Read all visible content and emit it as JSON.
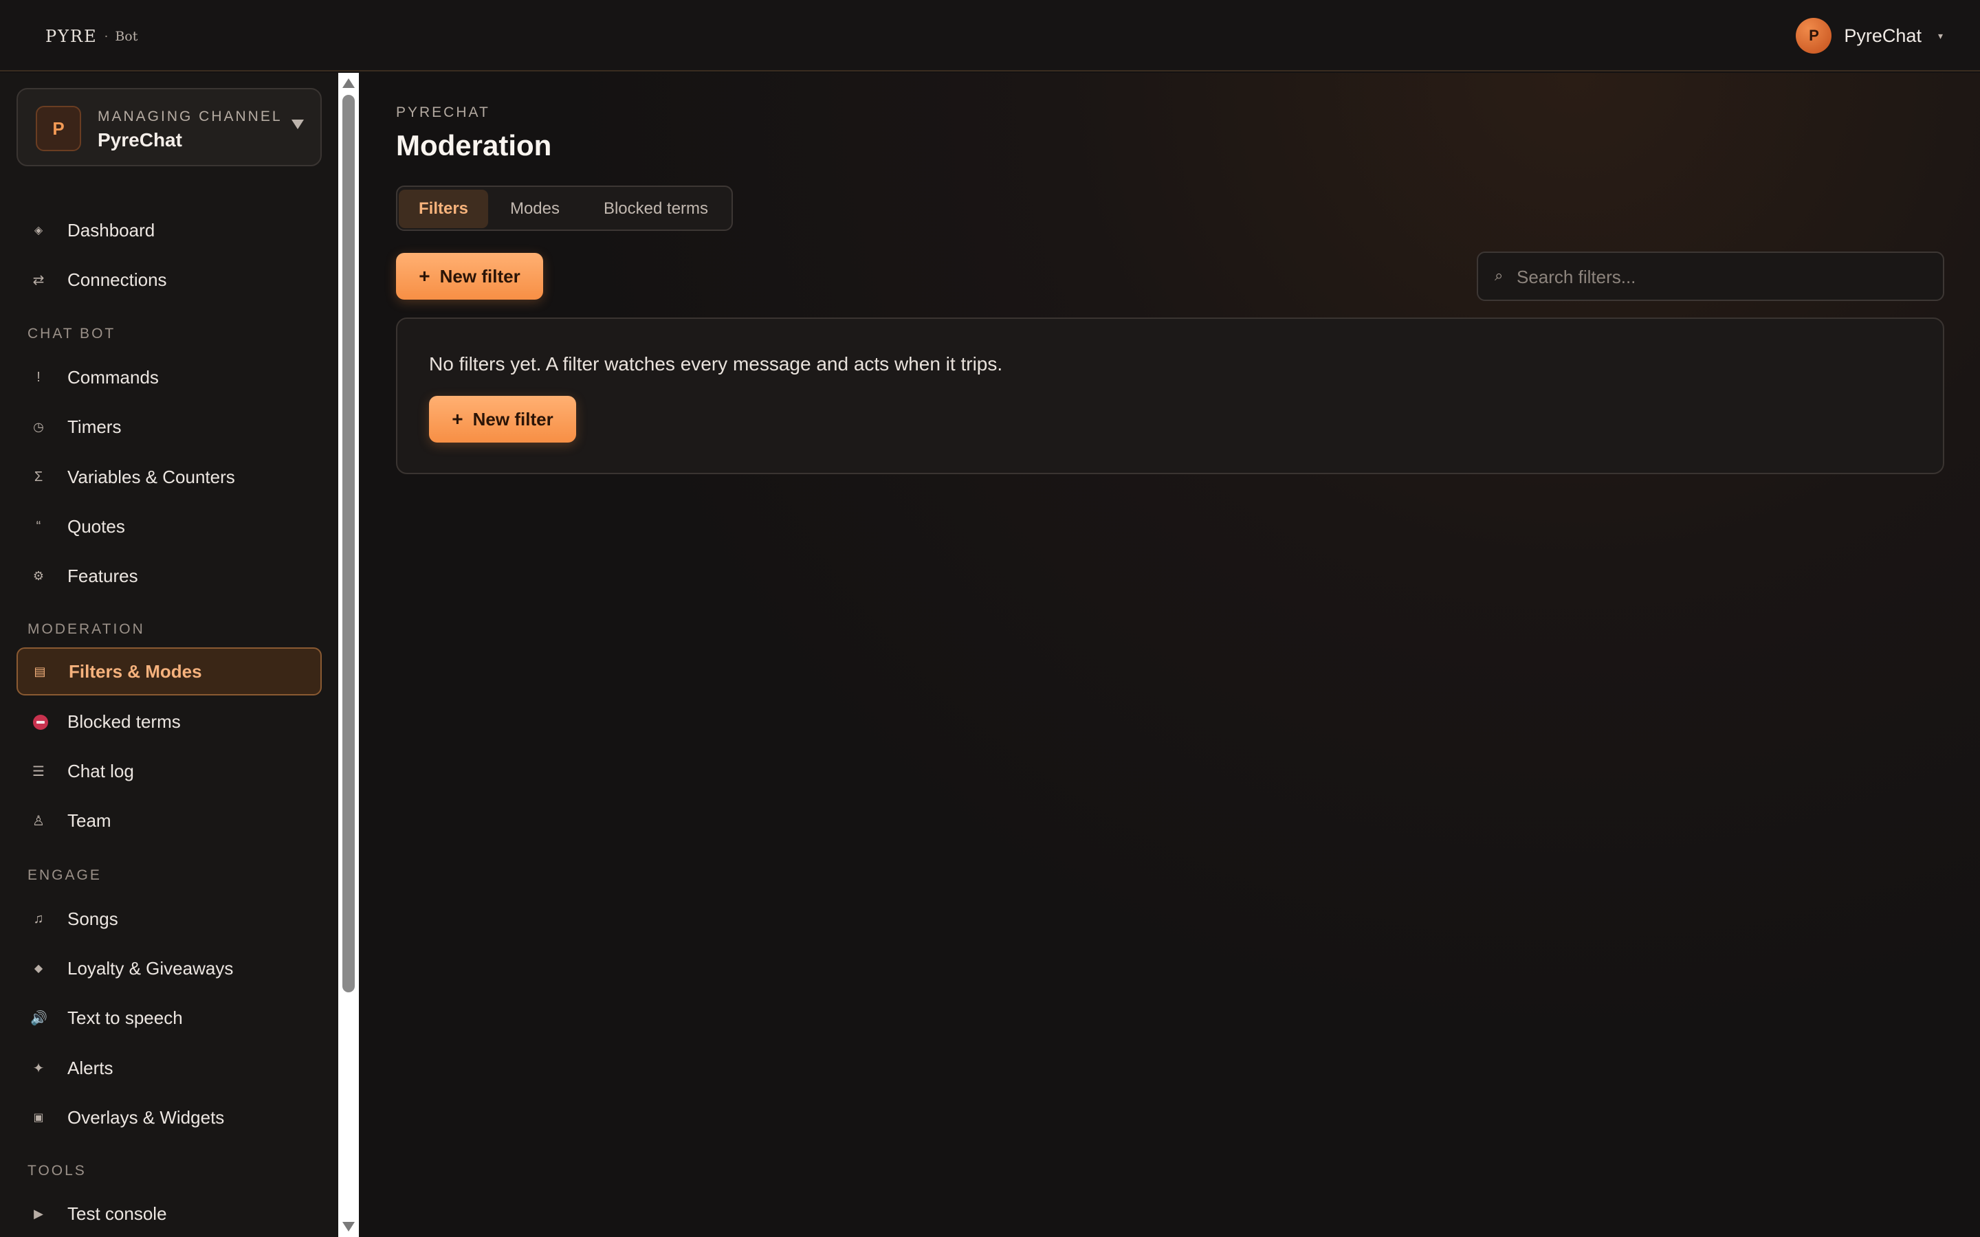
{
  "topbar": {
    "logo_text": "PYRE",
    "logo_separator": "·",
    "logo_sub": "Bot",
    "user_avatar_initial": "P",
    "user_name": "PyreChat"
  },
  "sidebar": {
    "channel": {
      "avatar_initial": "P",
      "label": "MANAGING CHANNEL",
      "name": "PyreChat"
    },
    "items": [
      {
        "label": "Dashboard",
        "icon": "diamond-icon"
      },
      {
        "label": "Connections",
        "icon": "arrows-icon"
      },
      {
        "section": "CHAT BOT"
      },
      {
        "label": "Commands",
        "icon": "exclamation-icon"
      },
      {
        "label": "Timers",
        "icon": "clock-icon"
      },
      {
        "label": "Variables & Counters",
        "icon": "sigma-icon"
      },
      {
        "label": "Quotes",
        "icon": "quote-icon"
      },
      {
        "label": "Features",
        "icon": "gear-icon"
      },
      {
        "section": "MODERATION"
      },
      {
        "label": "Filters & Modes",
        "icon": "filter-icon",
        "active": true
      },
      {
        "label": "Blocked terms",
        "icon": "no-entry-icon"
      },
      {
        "label": "Chat log",
        "icon": "list-icon"
      },
      {
        "label": "Team",
        "icon": "person-icon"
      },
      {
        "section": "ENGAGE"
      },
      {
        "label": "Songs",
        "icon": "music-icon"
      },
      {
        "label": "Loyalty & Giveaways",
        "icon": "gem-icon"
      },
      {
        "label": "Text to speech",
        "icon": "speaker-icon"
      },
      {
        "label": "Alerts",
        "icon": "sparkle-icon"
      },
      {
        "label": "Overlays & Widgets",
        "icon": "square-icon"
      },
      {
        "section": "TOOLS"
      },
      {
        "label": "Test console",
        "icon": "play-icon"
      }
    ]
  },
  "main": {
    "breadcrumb": "PYRECHAT",
    "title": "Moderation",
    "tabs": [
      {
        "label": "Filters",
        "active": true
      },
      {
        "label": "Modes"
      },
      {
        "label": "Blocked terms"
      }
    ],
    "new_filter_label": "New filter",
    "new_filter_icon": "+",
    "search": {
      "placeholder": "Search filters...",
      "value": "",
      "icon": "search-icon"
    },
    "empty_state": {
      "text": "No filters yet. A filter watches every message and acts when it trips.",
      "button_label": "New filter",
      "button_icon": "+"
    }
  },
  "colors": {
    "accent": "#f78f45",
    "accent_text": "#f7b37c",
    "background": "#141212",
    "danger": "#c8324e"
  }
}
